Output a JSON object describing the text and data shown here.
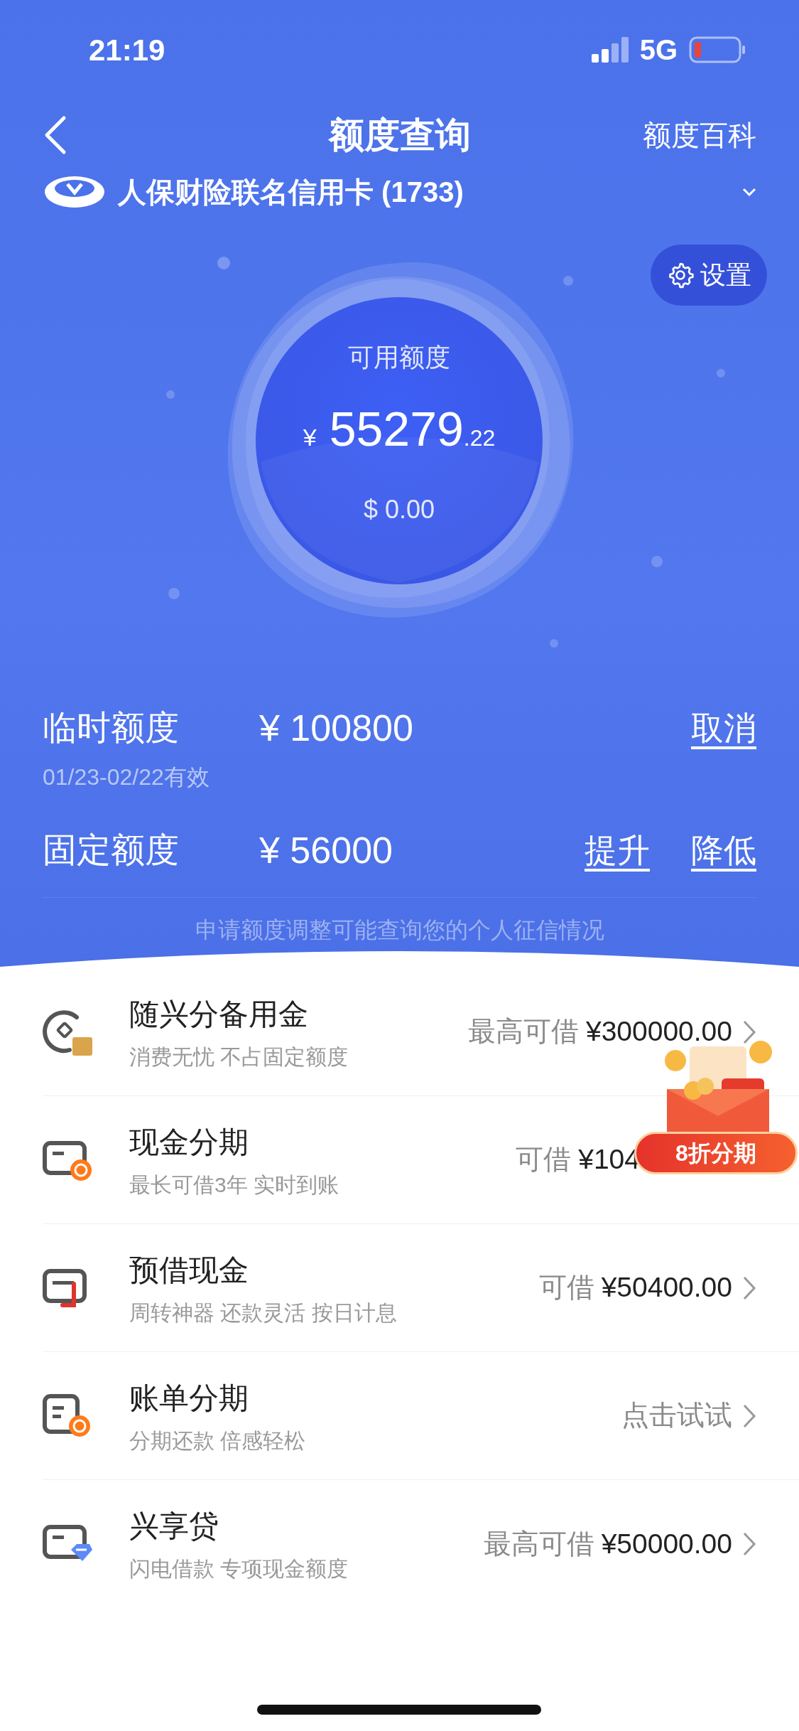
{
  "status_bar": {
    "time": "21:19",
    "network": "5G"
  },
  "nav": {
    "title": "额度查询",
    "right_link": "额度百科"
  },
  "card": {
    "name": "人保财险联名信用卡 (1733)"
  },
  "settings_button": {
    "label": "设置"
  },
  "balance": {
    "label": "可用额度",
    "currency": "¥",
    "integer": "55279",
    "decimal": ".22",
    "usd": "$ 0.00"
  },
  "limits": [
    {
      "label": "临时额度",
      "amount": "¥ 100800",
      "validity": "01/23-02/22有效",
      "actions": [
        "取消"
      ]
    },
    {
      "label": "固定额度",
      "amount": "¥ 56000",
      "actions": [
        "提升",
        "降低"
      ]
    }
  ],
  "notice": "申请额度调整可能查询您的个人征信情况",
  "products": [
    {
      "title": "随兴分备用金",
      "subtitle": "消费无忧 不占固定额度",
      "prefix": "最高可借",
      "amount": "¥300000.00"
    },
    {
      "title": "现金分期",
      "subtitle": "最长可借3年 实时到账",
      "prefix": "可借",
      "amount": "¥104"
    },
    {
      "title": "预借现金",
      "subtitle": "周转神器 还款灵活 按日计息",
      "prefix": "可借",
      "amount": "¥50400.00"
    },
    {
      "title": "账单分期",
      "subtitle": "分期还款 倍感轻松",
      "prefix": "点击试试"
    },
    {
      "title": "兴享贷",
      "subtitle": "闪电借款 专项现金额度",
      "prefix": "最高可借",
      "amount": "¥50000.00"
    }
  ],
  "promo_badge": {
    "label": "8折分期"
  }
}
